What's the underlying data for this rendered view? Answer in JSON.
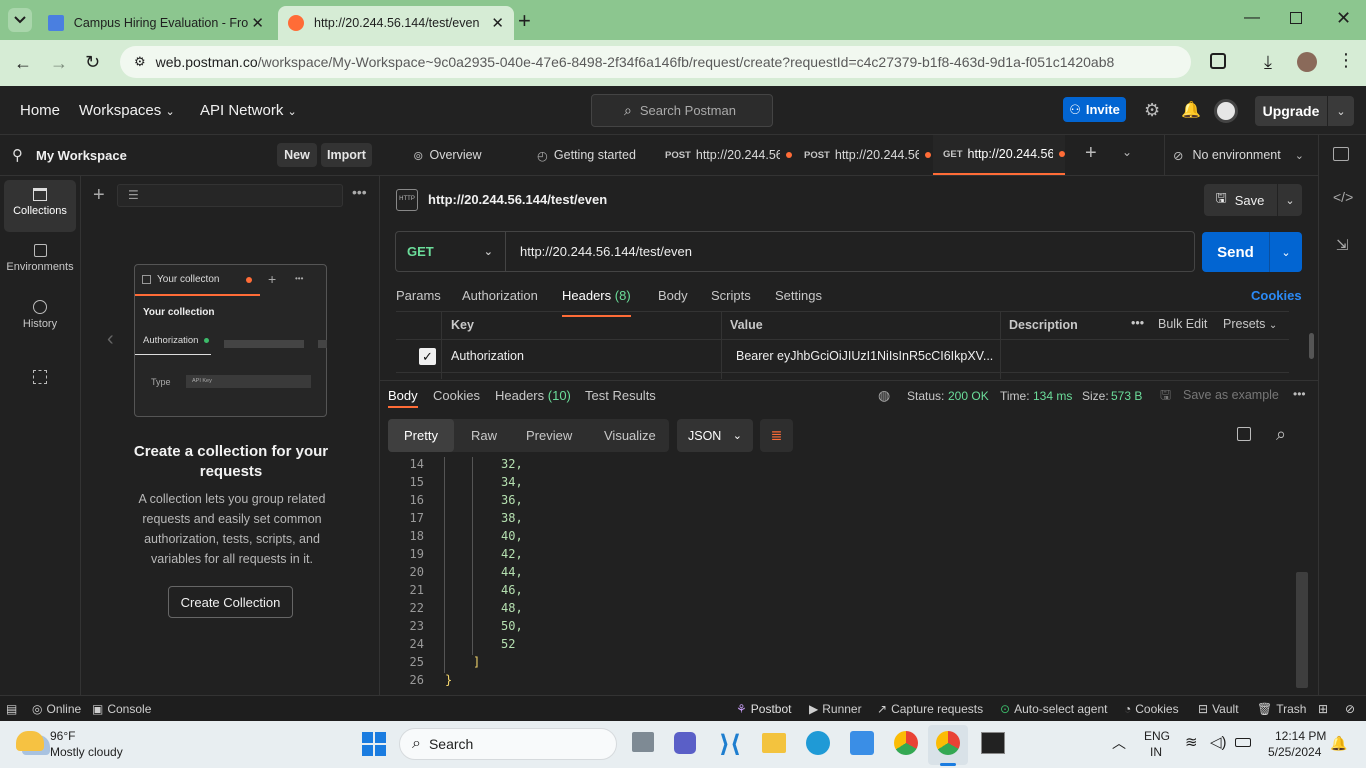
{
  "browser": {
    "tabs": [
      {
        "title": "Campus Hiring Evaluation - Fro"
      },
      {
        "title": "http://20.244.56.144/test/even"
      }
    ],
    "url": {
      "domain": "web.postman.co",
      "path": "/workspace/My-Workspace~9c0a2935-040e-47e6-8498-2f34f6a146fb/request/create?requestId=c4c27379-b1f8-463d-9d1a-f051c1420ab8"
    }
  },
  "header": {
    "home": "Home",
    "workspaces": "Workspaces",
    "api_network": "API Network",
    "search_placeholder": "Search Postman",
    "invite": "Invite",
    "upgrade": "Upgrade"
  },
  "workspace": {
    "name": "My Workspace",
    "new": "New",
    "import": "Import"
  },
  "rail": {
    "collections": "Collections",
    "environments": "Environments",
    "history": "History"
  },
  "empty_state": {
    "card_title": "Your collecton",
    "card_collection": "Your collection",
    "card_auth": "Authorization",
    "card_type": "Type",
    "card_type_value": "API Key",
    "heading": "Create a collection for your requests",
    "body": "A collection lets you group related requests and easily set common authorization, tests, scripts, and variables for all requests in it.",
    "button": "Create Collection"
  },
  "tabs": {
    "overview": "Overview",
    "getting_started": "Getting started",
    "req_tabs": [
      {
        "method": "POST",
        "label": "http://20.244.56"
      },
      {
        "method": "POST",
        "label": "http://20.244.56"
      },
      {
        "method": "GET",
        "label": "http://20.244.56.1"
      }
    ],
    "environment": "No environment"
  },
  "request": {
    "title": "http://20.244.56.144/test/even",
    "save": "Save",
    "method": "GET",
    "url": "http://20.244.56.144/test/even",
    "send": "Send",
    "subtabs": {
      "params": "Params",
      "authorization": "Authorization",
      "headers": "Headers",
      "headers_count": "(8)",
      "body": "Body",
      "scripts": "Scripts",
      "settings": "Settings"
    },
    "cookies": "Cookies",
    "table": {
      "key": "Key",
      "value": "Value",
      "description": "Description",
      "bulk_edit": "Bulk Edit",
      "presets": "Presets",
      "row_key": "Authorization",
      "row_value": "Bearer eyJhbGciOiJIUzI1NiIsInR5cCI6IkpXV..."
    }
  },
  "response": {
    "tabs": {
      "body": "Body",
      "cookies": "Cookies",
      "headers": "Headers",
      "headers_count": "(10)",
      "test_results": "Test Results"
    },
    "status_label": "Status:",
    "status": "200 OK",
    "time_label": "Time:",
    "time": "134 ms",
    "size_label": "Size:",
    "size": "573 B",
    "save_example": "Save as example",
    "views": {
      "pretty": "Pretty",
      "raw": "Raw",
      "preview": "Preview",
      "visualize": "Visualize"
    },
    "format": "JSON",
    "lines": [
      {
        "n": "14",
        "t": "32,"
      },
      {
        "n": "15",
        "t": "34,"
      },
      {
        "n": "16",
        "t": "36,"
      },
      {
        "n": "17",
        "t": "38,"
      },
      {
        "n": "18",
        "t": "40,"
      },
      {
        "n": "19",
        "t": "42,"
      },
      {
        "n": "20",
        "t": "44,"
      },
      {
        "n": "21",
        "t": "46,"
      },
      {
        "n": "22",
        "t": "48,"
      },
      {
        "n": "23",
        "t": "50,"
      },
      {
        "n": "24",
        "t": "52"
      },
      {
        "n": "25",
        "t": "]"
      },
      {
        "n": "26",
        "t": "}"
      }
    ]
  },
  "statusbar": {
    "online": "Online",
    "console": "Console",
    "postbot": "Postbot",
    "runner": "Runner",
    "capture": "Capture requests",
    "auto_select": "Auto-select agent",
    "cookies": "Cookies",
    "vault": "Vault",
    "trash": "Trash"
  },
  "taskbar": {
    "temp": "96°F",
    "weather": "Mostly cloudy",
    "search": "Search",
    "lang1": "ENG",
    "lang2": "IN",
    "time": "12:14 PM",
    "date": "5/25/2024"
  },
  "colors": {
    "accent": "#ff6c37",
    "send_blue": "#0265d2",
    "get_green": "#6bdd9a",
    "number_green": "#b5e0b0"
  }
}
